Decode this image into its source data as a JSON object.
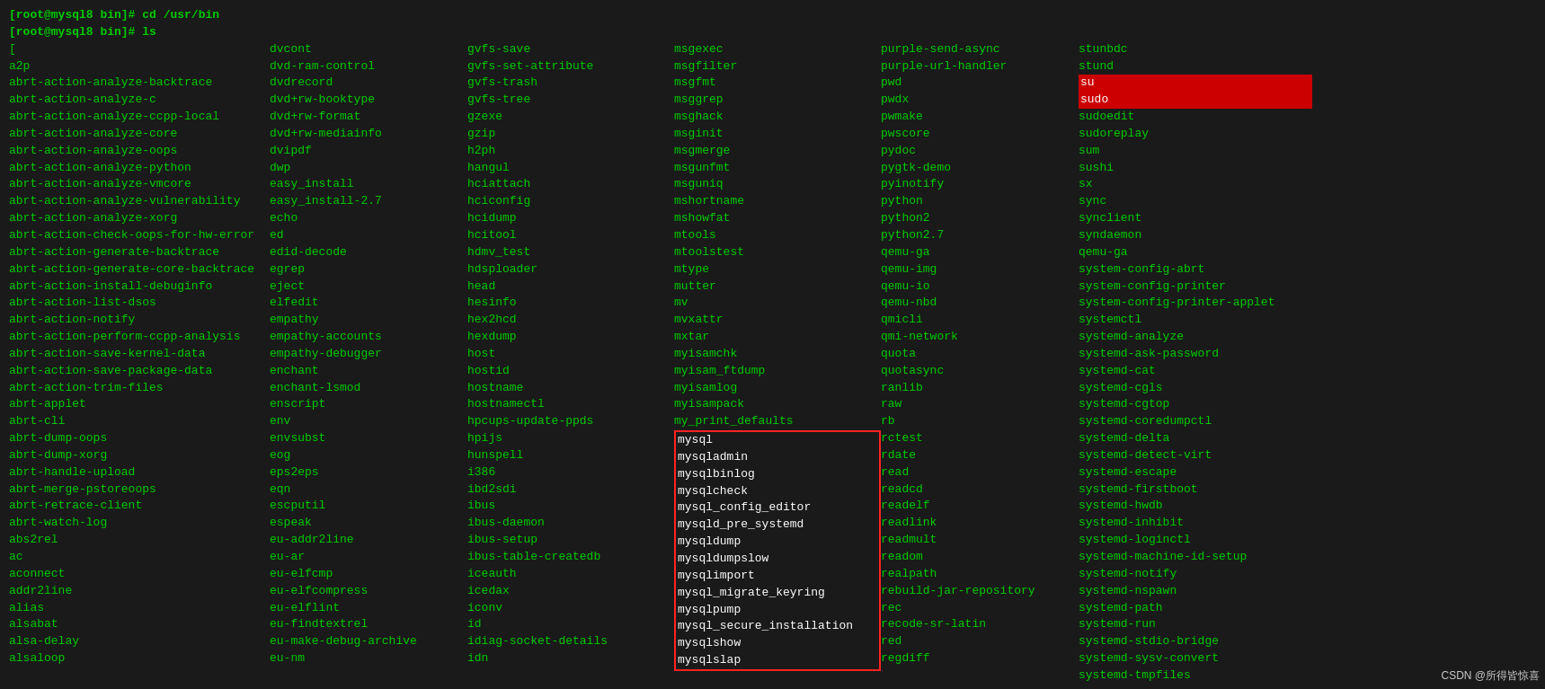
{
  "terminal": {
    "prompt1": "[root@mysql8 bin]# cd /usr/bin",
    "prompt2": "[root@mysql8 bin]# ls"
  },
  "columns": [
    {
      "id": "col1",
      "items": [
        {
          "text": "[",
          "style": "normal"
        },
        {
          "text": "a2p",
          "style": "normal"
        },
        {
          "text": "abrt-action-analyze-backtrace",
          "style": "normal"
        },
        {
          "text": "abrt-action-analyze-c",
          "style": "normal"
        },
        {
          "text": "abrt-action-analyze-ccpp-local",
          "style": "normal"
        },
        {
          "text": "abrt-action-analyze-core",
          "style": "normal"
        },
        {
          "text": "abrt-action-analyze-oops",
          "style": "normal"
        },
        {
          "text": "abrt-action-analyze-python",
          "style": "normal"
        },
        {
          "text": "abrt-action-analyze-vmcore",
          "style": "normal"
        },
        {
          "text": "abrt-action-analyze-vulnerability",
          "style": "normal"
        },
        {
          "text": "abrt-action-analyze-xorg",
          "style": "normal"
        },
        {
          "text": "abrt-action-check-oops-for-hw-error",
          "style": "normal"
        },
        {
          "text": "abrt-action-generate-backtrace",
          "style": "normal"
        },
        {
          "text": "abrt-action-generate-core-backtrace",
          "style": "normal"
        },
        {
          "text": "abrt-action-install-debuginfo",
          "style": "normal"
        },
        {
          "text": "abrt-action-list-dsos",
          "style": "normal"
        },
        {
          "text": "abrt-action-notify",
          "style": "normal"
        },
        {
          "text": "abrt-action-perform-ccpp-analysis",
          "style": "normal"
        },
        {
          "text": "abrt-action-save-kernel-data",
          "style": "normal"
        },
        {
          "text": "abrt-action-save-package-data",
          "style": "normal"
        },
        {
          "text": "abrt-action-trim-files",
          "style": "normal"
        },
        {
          "text": "abrt-applet",
          "style": "normal"
        },
        {
          "text": "abrt-cli",
          "style": "normal"
        },
        {
          "text": "abrt-dump-oops",
          "style": "normal"
        },
        {
          "text": "abrt-dump-xorg",
          "style": "normal"
        },
        {
          "text": "abrt-handle-upload",
          "style": "normal"
        },
        {
          "text": "abrt-merge-pstoreoops",
          "style": "normal"
        },
        {
          "text": "abrt-retrace-client",
          "style": "normal"
        },
        {
          "text": "abrt-watch-log",
          "style": "normal"
        },
        {
          "text": "abs2rel",
          "style": "normal"
        },
        {
          "text": "ac",
          "style": "normal"
        },
        {
          "text": "aconnect",
          "style": "normal"
        },
        {
          "text": "addr2line",
          "style": "normal"
        },
        {
          "text": "alias",
          "style": "normal"
        },
        {
          "text": "alsabat",
          "style": "normal"
        },
        {
          "text": "alsa-delay",
          "style": "normal"
        },
        {
          "text": "alsaloop",
          "style": "normal"
        }
      ]
    },
    {
      "id": "col2",
      "items": [
        {
          "text": "dvcont",
          "style": "normal"
        },
        {
          "text": "dvd-ram-control",
          "style": "normal"
        },
        {
          "text": "dvdrecord",
          "style": "normal"
        },
        {
          "text": "dvd+rw-booktype",
          "style": "normal"
        },
        {
          "text": "dvd+rw-format",
          "style": "normal"
        },
        {
          "text": "dvd+rw-mediainfo",
          "style": "normal"
        },
        {
          "text": "dvipdf",
          "style": "normal"
        },
        {
          "text": "dwp",
          "style": "normal"
        },
        {
          "text": "easy_install",
          "style": "normal"
        },
        {
          "text": "easy_install-2.7",
          "style": "normal"
        },
        {
          "text": "echo",
          "style": "normal"
        },
        {
          "text": "ed",
          "style": "normal"
        },
        {
          "text": "edid-decode",
          "style": "normal"
        },
        {
          "text": "egrep",
          "style": "normal"
        },
        {
          "text": "eject",
          "style": "normal"
        },
        {
          "text": "elfedit",
          "style": "normal"
        },
        {
          "text": "empathy",
          "style": "normal"
        },
        {
          "text": "empathy-accounts",
          "style": "normal"
        },
        {
          "text": "empathy-debugger",
          "style": "normal"
        },
        {
          "text": "enchant",
          "style": "normal"
        },
        {
          "text": "enchant-lsmod",
          "style": "normal"
        },
        {
          "text": "enscript",
          "style": "normal"
        },
        {
          "text": "env",
          "style": "normal"
        },
        {
          "text": "envsubst",
          "style": "normal"
        },
        {
          "text": "eog",
          "style": "normal"
        },
        {
          "text": "eps2eps",
          "style": "normal"
        },
        {
          "text": "eqn",
          "style": "normal"
        },
        {
          "text": "escputil",
          "style": "normal"
        },
        {
          "text": "espeak",
          "style": "normal"
        },
        {
          "text": "eu-addr2line",
          "style": "normal"
        },
        {
          "text": "eu-ar",
          "style": "normal"
        },
        {
          "text": "eu-elfcmp",
          "style": "normal"
        },
        {
          "text": "eu-elfcompress",
          "style": "normal"
        },
        {
          "text": "eu-elflint",
          "style": "normal"
        },
        {
          "text": "eu-findtextrel",
          "style": "normal"
        },
        {
          "text": "eu-make-debug-archive",
          "style": "normal"
        },
        {
          "text": "eu-nm",
          "style": "normal"
        }
      ]
    },
    {
      "id": "col3",
      "items": [
        {
          "text": "gvfs-save",
          "style": "normal"
        },
        {
          "text": "gvfs-set-attribute",
          "style": "normal"
        },
        {
          "text": "gvfs-trash",
          "style": "normal"
        },
        {
          "text": "gvfs-tree",
          "style": "normal"
        },
        {
          "text": "gzexe",
          "style": "normal"
        },
        {
          "text": "gzip",
          "style": "normal"
        },
        {
          "text": "h2ph",
          "style": "normal"
        },
        {
          "text": "hangul",
          "style": "normal"
        },
        {
          "text": "hciattach",
          "style": "normal"
        },
        {
          "text": "hciconfig",
          "style": "normal"
        },
        {
          "text": "hcidump",
          "style": "normal"
        },
        {
          "text": "hcitool",
          "style": "normal"
        },
        {
          "text": "hdmv_test",
          "style": "normal"
        },
        {
          "text": "hdsploader",
          "style": "normal"
        },
        {
          "text": "head",
          "style": "normal"
        },
        {
          "text": "hesinfo",
          "style": "normal"
        },
        {
          "text": "hex2hcd",
          "style": "normal"
        },
        {
          "text": "hexdump",
          "style": "normal"
        },
        {
          "text": "host",
          "style": "normal"
        },
        {
          "text": "hostid",
          "style": "normal"
        },
        {
          "text": "hostname",
          "style": "normal"
        },
        {
          "text": "hostnamectl",
          "style": "normal"
        },
        {
          "text": "hpcups-update-ppds",
          "style": "normal"
        },
        {
          "text": "hpijs",
          "style": "normal"
        },
        {
          "text": "hunspell",
          "style": "normal"
        },
        {
          "text": "i386",
          "style": "normal"
        },
        {
          "text": "ibd2sdi",
          "style": "normal"
        },
        {
          "text": "ibus",
          "style": "normal"
        },
        {
          "text": "ibus-daemon",
          "style": "normal"
        },
        {
          "text": "ibus-setup",
          "style": "normal"
        },
        {
          "text": "ibus-table-createdb",
          "style": "normal"
        },
        {
          "text": "iceauth",
          "style": "normal"
        },
        {
          "text": "icedax",
          "style": "normal"
        },
        {
          "text": "iconv",
          "style": "normal"
        },
        {
          "text": "id",
          "style": "normal"
        },
        {
          "text": "idiag-socket-details",
          "style": "normal"
        },
        {
          "text": "idn",
          "style": "normal"
        }
      ]
    },
    {
      "id": "col4",
      "items": [
        {
          "text": "msgexec",
          "style": "normal"
        },
        {
          "text": "msgfilter",
          "style": "normal"
        },
        {
          "text": "msgfmt",
          "style": "normal"
        },
        {
          "text": "msggrep",
          "style": "normal"
        },
        {
          "text": "msghack",
          "style": "normal"
        },
        {
          "text": "msginit",
          "style": "normal"
        },
        {
          "text": "msgmerge",
          "style": "normal"
        },
        {
          "text": "msgunfmt",
          "style": "normal"
        },
        {
          "text": "msguniq",
          "style": "normal"
        },
        {
          "text": "mshortname",
          "style": "normal"
        },
        {
          "text": "mshowfat",
          "style": "normal"
        },
        {
          "text": "mtools",
          "style": "normal"
        },
        {
          "text": "mtoolstest",
          "style": "normal"
        },
        {
          "text": "mtype",
          "style": "normal"
        },
        {
          "text": "mutter",
          "style": "normal"
        },
        {
          "text": "mv",
          "style": "normal"
        },
        {
          "text": "mvxattr",
          "style": "normal"
        },
        {
          "text": "mxtar",
          "style": "normal"
        },
        {
          "text": "myisamchk",
          "style": "normal"
        },
        {
          "text": "myisam_ftdump",
          "style": "normal"
        },
        {
          "text": "myisamlog",
          "style": "normal"
        },
        {
          "text": "myisampack",
          "style": "normal"
        },
        {
          "text": "my_print_defaults",
          "style": "normal"
        },
        {
          "text": "mysql",
          "style": "mysql-box"
        },
        {
          "text": "mysqladmin",
          "style": "mysql-box"
        },
        {
          "text": "mysqlbinlog",
          "style": "mysql-box"
        },
        {
          "text": "mysqlcheck",
          "style": "mysql-box"
        },
        {
          "text": "mysql_config_editor",
          "style": "mysql-box"
        },
        {
          "text": "mysqld_pre_systemd",
          "style": "mysql-box"
        },
        {
          "text": "mysqldump",
          "style": "mysql-box"
        },
        {
          "text": "mysqldumpslow",
          "style": "mysql-box"
        },
        {
          "text": "mysqlimport",
          "style": "mysql-box"
        },
        {
          "text": "mysql_migrate_keyring",
          "style": "mysql-box"
        },
        {
          "text": "mysqlpump",
          "style": "mysql-box"
        },
        {
          "text": "mysql_secure_installation",
          "style": "mysql-box"
        },
        {
          "text": "mysqlshow",
          "style": "mysql-box"
        },
        {
          "text": "mysqlslap",
          "style": "mysql-box"
        }
      ]
    },
    {
      "id": "col5",
      "items": [
        {
          "text": "purple-send-async",
          "style": "normal"
        },
        {
          "text": "purple-url-handler",
          "style": "normal"
        },
        {
          "text": "pwd",
          "style": "normal"
        },
        {
          "text": "pwdx",
          "style": "normal"
        },
        {
          "text": "pwmake",
          "style": "normal"
        },
        {
          "text": "pwscore",
          "style": "normal"
        },
        {
          "text": "pydoc",
          "style": "normal"
        },
        {
          "text": "pygtk-demo",
          "style": "normal"
        },
        {
          "text": "pyinotify",
          "style": "normal"
        },
        {
          "text": "python",
          "style": "normal"
        },
        {
          "text": "python2",
          "style": "normal"
        },
        {
          "text": "python2.7",
          "style": "normal"
        },
        {
          "text": "qemu-ga",
          "style": "normal"
        },
        {
          "text": "qemu-img",
          "style": "normal"
        },
        {
          "text": "qemu-io",
          "style": "normal"
        },
        {
          "text": "qemu-nbd",
          "style": "normal"
        },
        {
          "text": "qmicli",
          "style": "normal"
        },
        {
          "text": "qmi-network",
          "style": "normal"
        },
        {
          "text": "quota",
          "style": "normal"
        },
        {
          "text": "quotasync",
          "style": "normal"
        },
        {
          "text": "ranlib",
          "style": "normal"
        },
        {
          "text": "raw",
          "style": "normal"
        },
        {
          "text": "rb",
          "style": "normal"
        },
        {
          "text": "rctest",
          "style": "normal"
        },
        {
          "text": "rdate",
          "style": "normal"
        },
        {
          "text": "read",
          "style": "normal"
        },
        {
          "text": "readcd",
          "style": "normal"
        },
        {
          "text": "readelf",
          "style": "normal"
        },
        {
          "text": "readlink",
          "style": "normal"
        },
        {
          "text": "readmult",
          "style": "normal"
        },
        {
          "text": "readom",
          "style": "normal"
        },
        {
          "text": "realpath",
          "style": "normal"
        },
        {
          "text": "rebuild-jar-repository",
          "style": "normal"
        },
        {
          "text": "rec",
          "style": "normal"
        },
        {
          "text": "recode-sr-latin",
          "style": "normal"
        },
        {
          "text": "red",
          "style": "normal"
        },
        {
          "text": "regdiff",
          "style": "normal"
        }
      ]
    },
    {
      "id": "col6",
      "items": [
        {
          "text": "stunbdc",
          "style": "normal"
        },
        {
          "text": "stund",
          "style": "normal"
        },
        {
          "text": "su",
          "style": "highlighted"
        },
        {
          "text": "sudo",
          "style": "highlighted"
        },
        {
          "text": "sudoedit",
          "style": "normal"
        },
        {
          "text": "sudoreplay",
          "style": "normal"
        },
        {
          "text": "sum",
          "style": "normal"
        },
        {
          "text": "sushi",
          "style": "normal"
        },
        {
          "text": "sx",
          "style": "normal"
        },
        {
          "text": "sync",
          "style": "normal"
        },
        {
          "text": "synclient",
          "style": "normal"
        },
        {
          "text": "syndaemon",
          "style": "normal"
        },
        {
          "text": "qemu-ga",
          "style": "normal"
        },
        {
          "text": "system-config-abrt",
          "style": "normal"
        },
        {
          "text": "system-config-printer",
          "style": "normal"
        },
        {
          "text": "system-config-printer-applet",
          "style": "normal"
        },
        {
          "text": "systemctl",
          "style": "normal"
        },
        {
          "text": "systemd-analyze",
          "style": "normal"
        },
        {
          "text": "systemd-ask-password",
          "style": "normal"
        },
        {
          "text": "systemd-cat",
          "style": "normal"
        },
        {
          "text": "systemd-cgls",
          "style": "normal"
        },
        {
          "text": "systemd-cgtop",
          "style": "normal"
        },
        {
          "text": "systemd-coredumpctl",
          "style": "normal"
        },
        {
          "text": "systemd-delta",
          "style": "normal"
        },
        {
          "text": "systemd-detect-virt",
          "style": "normal"
        },
        {
          "text": "systemd-escape",
          "style": "normal"
        },
        {
          "text": "systemd-firstboot",
          "style": "normal"
        },
        {
          "text": "systemd-hwdb",
          "style": "normal"
        },
        {
          "text": "systemd-inhibit",
          "style": "normal"
        },
        {
          "text": "systemd-loginctl",
          "style": "normal"
        },
        {
          "text": "systemd-machine-id-setup",
          "style": "normal"
        },
        {
          "text": "systemd-notify",
          "style": "normal"
        },
        {
          "text": "systemd-nspawn",
          "style": "normal"
        },
        {
          "text": "systemd-path",
          "style": "normal"
        },
        {
          "text": "systemd-run",
          "style": "normal"
        },
        {
          "text": "systemd-stdio-bridge",
          "style": "normal"
        },
        {
          "text": "systemd-sysv-convert",
          "style": "normal"
        },
        {
          "text": "systemd-tmpfiles",
          "style": "normal"
        }
      ]
    }
  ],
  "watermark": "CSDN @所得皆惊喜"
}
